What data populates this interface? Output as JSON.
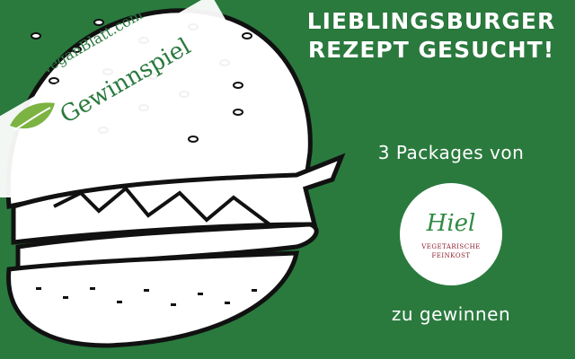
{
  "headline": {
    "line1": "Lieblingsburger",
    "line2": "Rezept gesucht!"
  },
  "prize": {
    "intro": "3 Packages von",
    "outro": "zu gewinnen"
  },
  "sponsor_logo": {
    "name": "Hiel",
    "tagline_line1": "VEGETARISCHE",
    "tagline_line2": "FEINKOST"
  },
  "banner": {
    "site": "VeganBlatt.com",
    "label": "Gewinnspiel"
  },
  "colors": {
    "background": "#2a7a3e",
    "banner": "#ffffff",
    "logo_green": "#2f8a43",
    "logo_red": "#8a1c2a"
  },
  "icons": [
    "burger-illustration",
    "leaf-logo-icon"
  ]
}
